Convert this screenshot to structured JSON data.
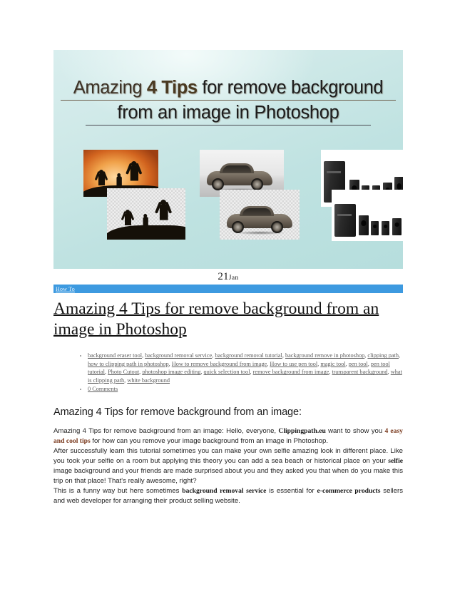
{
  "banner": {
    "title_line1_lead": "Amazing ",
    "title_line1_bold": "4 Tips",
    "title_line1_tail": " for remove background",
    "title_line2": "from an image in Photoshop",
    "alt": "Amazing 4 Tips for remove background from an image in Photoshop",
    "accent_color": "#b7dedd"
  },
  "post": {
    "date_day": "21",
    "date_month": "Jan",
    "category": "How To",
    "category_bar_color": "#3d9ae0",
    "title": "Amazing 4 Tips for remove background from an image in Photoshop",
    "comments": "0 Comments",
    "tags": [
      "background eraser tool",
      "background removal service",
      "background removal tutorial",
      "background remove in photoshop",
      "clipping path",
      "how to clipping path in photoshop",
      "How to remove background from image",
      "How to use pen tool",
      "magic tool",
      "pen tool",
      "pen tool tutorial",
      "Photo Cutout",
      "photoshop image editing",
      "quick selection tool",
      "remove background from image",
      "transparent background",
      "what is clipping path",
      "white background"
    ]
  },
  "article": {
    "heading": "Amazing 4 Tips for remove background from an image:",
    "para1_a": "Amazing 4 Tips for remove background from an image: Hello, everyone, ",
    "para1_brand": "Clippingpath.eu",
    "para1_b": " want to show you ",
    "para1_accent": "4 easy and cool tips",
    "para1_c": " for how can you remove your image background from an image in Photoshop.",
    "para2_a": "After successfully learn this tutorial sometimes you can make your own selfie amazing look in different place. Like you took your selfie on a room but applying this theory you can add a sea beach or historical place on your ",
    "para2_kw": "selfie",
    "para2_b": " image background and your friends are made surprised about you and they asked you that when do you make this trip on that place! That's really awesome, right?",
    "para3_a": "This is a funny way but here sometimes ",
    "para3_kw1": "background removal service",
    "para3_b": " is essential for ",
    "para3_kw2": "e-commerce products",
    "para3_c": " sellers and web developer for arranging their product selling website."
  }
}
